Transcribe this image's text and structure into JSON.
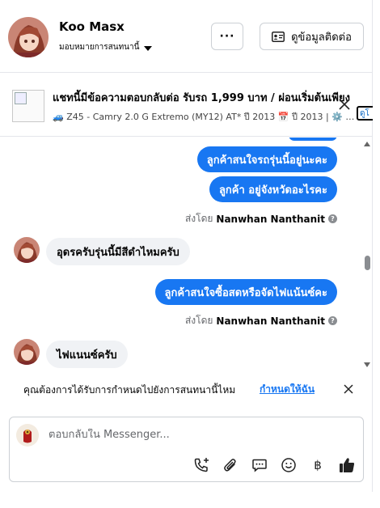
{
  "header": {
    "name": "Koo Masx",
    "assign_label": "มอบหมายการสนทนานี้",
    "more_label": "···",
    "contact_button_label": "ดูข้อมูลติดต่อ"
  },
  "ad": {
    "title": "แชทนี้มีข้อความตอบกลับต่อ รับรถ 1,999 บาท / ผ่อนเริ่มต้นเพียง",
    "subtitle_car_icon": "🚙",
    "subtitle_part1": "Z45 - Camry 2.0 G Extremo (MY12) AT* ปี 2013",
    "subtitle_cal_icon": "📅",
    "subtitle_part2": "ปี 2013 |",
    "subtitle_gear_icon": "⚙️",
    "subtitle_ellipsis": "…",
    "link_label": "ดูโ"
  },
  "messages": {
    "out1": "ลูกค้าสนใจรถรุ่นนี้อยู่นะคะ",
    "out2": "ลูกค้า  อยู่จังหวัดอะไรคะ",
    "sent_by_1_prefix": "ส่งโดย",
    "sent_by_1_name": "Nanwhan Nanthanit",
    "in1": "อุดรครับรุ่นนี้มีสีดำไหมครับ",
    "out3": "ลูกค้าสนใจซื้อสดหรือจัดไฟแน้นซ์คะ",
    "sent_by_2_prefix": "ส่งโดย",
    "sent_by_2_name": "Nanwhan Nanthanit",
    "in2": "ไฟแนนซ์ครับ"
  },
  "prompt": {
    "text": "คุณต้องการได้รับการกำหนดไปยังการสนทนานี้ไหม",
    "link": "กำหนดให้ฉัน"
  },
  "composer": {
    "placeholder": "ตอบกลับใน Messenger..."
  },
  "tool_icons": [
    "phone-add-icon",
    "paperclip-icon",
    "chat-bubble-icon",
    "smile-icon",
    "baht-icon",
    "thumbs-up-icon"
  ],
  "tool_glyphs": {
    "baht": "฿"
  },
  "colors": {
    "accent": "#1877f2",
    "bubble_incoming": "#f0f2f5",
    "border": "#ccd0d5"
  }
}
